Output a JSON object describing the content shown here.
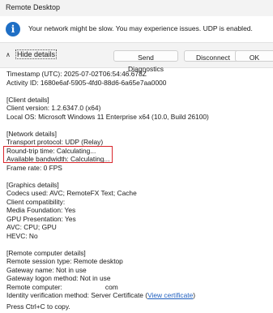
{
  "window": {
    "title": "Remote Desktop"
  },
  "banner": {
    "icon": "info-icon",
    "icon_glyph": "i",
    "message": "Your network might be slow. You may experience issues. UDP is enabled."
  },
  "toolbar": {
    "toggle_chevron": "∧",
    "toggle_label": "Hide details",
    "send_diagnostics_label": "Send Diagnostics",
    "disconnect_label": "Disconnect",
    "ok_label": "OK"
  },
  "details": {
    "timestamp": "Timestamp (UTC): 2025-07-02T06:54:46.678Z",
    "activity_id": "Activity ID: 1680e6af-5905-4fd0-88d6-6a65e7aa0000",
    "client_header": "[Client details]",
    "client_version": "Client version: 1.2.6347.0 (x64)",
    "local_os": "Local OS: Microsoft Windows 11 Enterprise x64 (10.0, Build 26100)",
    "network_header": "[Network details]",
    "transport_protocol": "Transport protocol: UDP (Relay)",
    "round_trip_time": "Round-trip time: Calculating...",
    "available_bandwidth": "Available bandwidth: Calculating...",
    "frame_rate": "Frame rate: 0 FPS",
    "graphics_header": "[Graphics details]",
    "codecs_used": "Codecs used: AVC; RemoteFX Text; Cache",
    "client_compatibility": "Client compatibility:",
    "media_foundation": "Media Foundation: Yes",
    "gpu_presentation": "GPU Presentation: Yes",
    "avc": "AVC: CPU; GPU",
    "hevc": "HEVC: No",
    "remote_header": "[Remote computer details]",
    "remote_session_type": "Remote session type: Remote desktop",
    "gateway_name": "Gateway name: Not in use",
    "gateway_logon_method": "Gateway logon method: Not in use",
    "remote_computer_prefix": "Remote computer:",
    "remote_computer_suffix": "com",
    "identity_prefix": "Identity verification method: Server Certificate (",
    "view_certificate_link": "View certificate",
    "identity_suffix": ")"
  },
  "footer": {
    "copy_hint": "Press Ctrl+C to copy."
  },
  "colors": {
    "titlebar_bg": "#f3f3f3",
    "info_icon": "#1f6fc5",
    "highlight_border": "#d9262b",
    "link": "#1f5fbf"
  }
}
